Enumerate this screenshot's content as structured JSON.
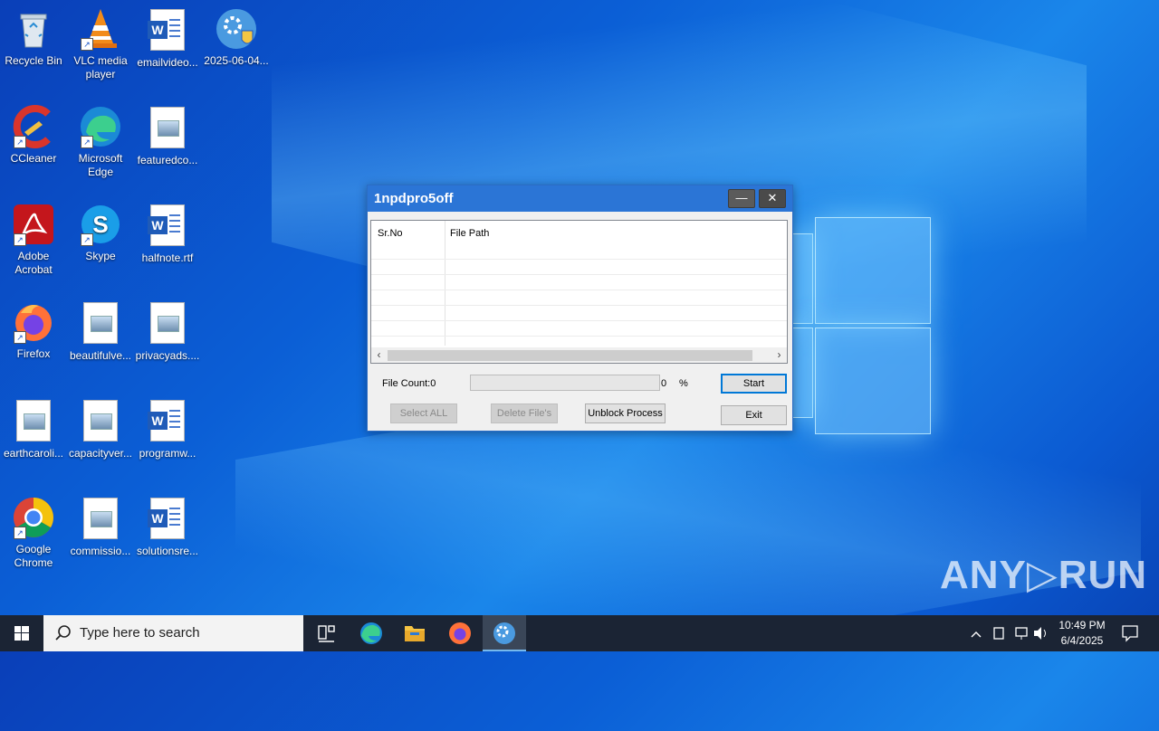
{
  "desktop": {
    "icons": [
      {
        "label": "Recycle Bin"
      },
      {
        "label": "VLC media player"
      },
      {
        "label": "emailvideo..."
      },
      {
        "label": "2025-06-04..."
      },
      {
        "label": "CCleaner"
      },
      {
        "label": "Microsoft Edge"
      },
      {
        "label": "featuredco..."
      },
      {
        "label": "Adobe Acrobat"
      },
      {
        "label": "Skype"
      },
      {
        "label": "halfnote.rtf"
      },
      {
        "label": "Firefox"
      },
      {
        "label": "beautifulve..."
      },
      {
        "label": "privacyads...."
      },
      {
        "label": "earthcaroli..."
      },
      {
        "label": "capacityver..."
      },
      {
        "label": "programw..."
      },
      {
        "label": "Google Chrome"
      },
      {
        "label": "commissio..."
      },
      {
        "label": "solutionsre..."
      }
    ]
  },
  "dialog": {
    "title": "1npdpro5off",
    "minimize_symbol": "—",
    "close_symbol": "✕",
    "columns": [
      "Sr.No",
      "File Path"
    ],
    "file_count_label": "File Count:0",
    "progress_value": "0",
    "progress_fraction": 0,
    "percent_sign": "%",
    "start_label": "Start",
    "select_all_label": "Select ALL",
    "delete_label": "Delete File's",
    "unblock_label": "Unblock Process",
    "exit_label": "Exit"
  },
  "watermark": "ANY▷RUN",
  "taskbar": {
    "search_placeholder": "Type here to search",
    "time": "10:49 PM",
    "date": "6/4/2025"
  },
  "colors": {
    "titlebar": "#2b75d6",
    "taskbar": "#1b2434",
    "progress_fill": "#06b025"
  }
}
